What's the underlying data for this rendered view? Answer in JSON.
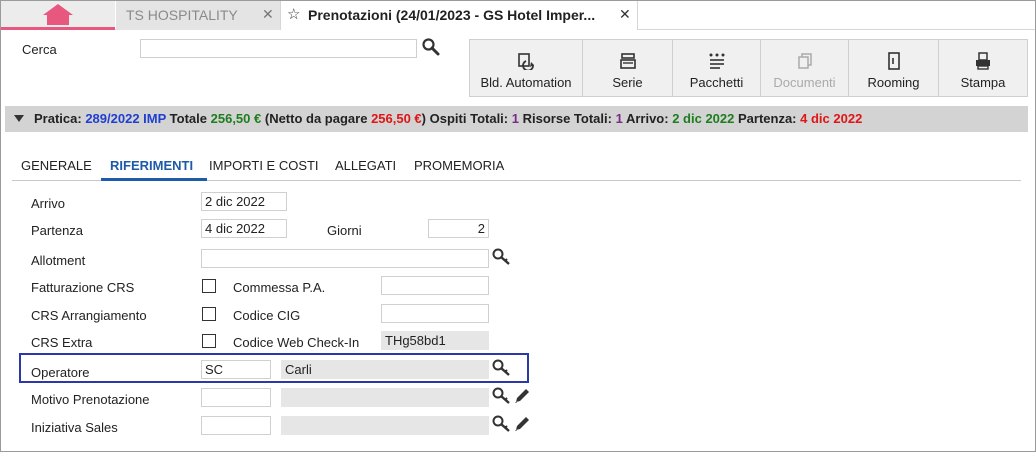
{
  "tabs": {
    "home_icon": "home-icon",
    "ts_label": "TS HOSPITALITY",
    "active_label": "Prenotazioni (24/01/2023 - GS Hotel Imper...",
    "close_glyph": "✕",
    "star_glyph": "☆"
  },
  "search": {
    "label": "Cerca",
    "value": ""
  },
  "toolbar": [
    {
      "label": "Bld. Automation",
      "icon": "building-automation-icon",
      "enabled": true
    },
    {
      "label": "Serie",
      "icon": "series-icon",
      "enabled": true
    },
    {
      "label": "Pacchetti",
      "icon": "packages-icon",
      "enabled": true
    },
    {
      "label": "Documenti",
      "icon": "documents-icon",
      "enabled": false
    },
    {
      "label": "Rooming",
      "icon": "rooming-icon",
      "enabled": true
    },
    {
      "label": "Stampa",
      "icon": "print-icon",
      "enabled": true
    }
  ],
  "summary": {
    "pratica_label": "Pratica:",
    "pratica_value": "289/2022 IMP",
    "totale_label": "Totale",
    "totale_value": "256,50 €",
    "netto_label": "(Netto da pagare",
    "netto_value": "256,50 €",
    "netto_close": ")",
    "ospiti_label": "Ospiti Totali:",
    "ospiti_value": "1",
    "risorse_label": "Risorse Totali:",
    "risorse_value": "1",
    "arrivo_label": "Arrivo:",
    "arrivo_value": "2 dic 2022",
    "partenza_label": "Partenza:",
    "partenza_value": "4 dic 2022",
    "colors": {
      "blue": "#1f3fd0",
      "green": "#1e7d1e",
      "red": "#e01515",
      "purple": "#7a2a8a"
    }
  },
  "section_tabs": [
    {
      "label": "GENERALE",
      "active": false
    },
    {
      "label": "RIFERIMENTI",
      "active": true
    },
    {
      "label": "IMPORTI E COSTI",
      "active": false
    },
    {
      "label": "ALLEGATI",
      "active": false
    },
    {
      "label": "PROMEMORIA",
      "active": false
    }
  ],
  "form": {
    "arrivo_label": "Arrivo",
    "arrivo_value": "2 dic 2022",
    "partenza_label": "Partenza",
    "partenza_value": "4 dic 2022",
    "giorni_label": "Giorni",
    "giorni_value": "2",
    "allotment_label": "Allotment",
    "allotment_value": "",
    "fatturazione_label": "Fatturazione CRS",
    "commessa_label": "Commessa P.A.",
    "commessa_value": "",
    "crs_arrangiamento_label": "CRS Arrangiamento",
    "codice_cig_label": "Codice CIG",
    "codice_cig_value": "",
    "crs_extra_label": "CRS Extra",
    "webcheckin_label": "Codice Web Check-In",
    "webcheckin_value": "THg58bd1",
    "operatore_label": "Operatore",
    "operatore_code": "SC",
    "operatore_name": "Carli",
    "motivo_label": "Motivo Prenotazione",
    "motivo_code": "",
    "motivo_name": "",
    "iniziativa_label": "Iniziativa Sales",
    "iniziativa_code": "",
    "iniziativa_name": ""
  }
}
